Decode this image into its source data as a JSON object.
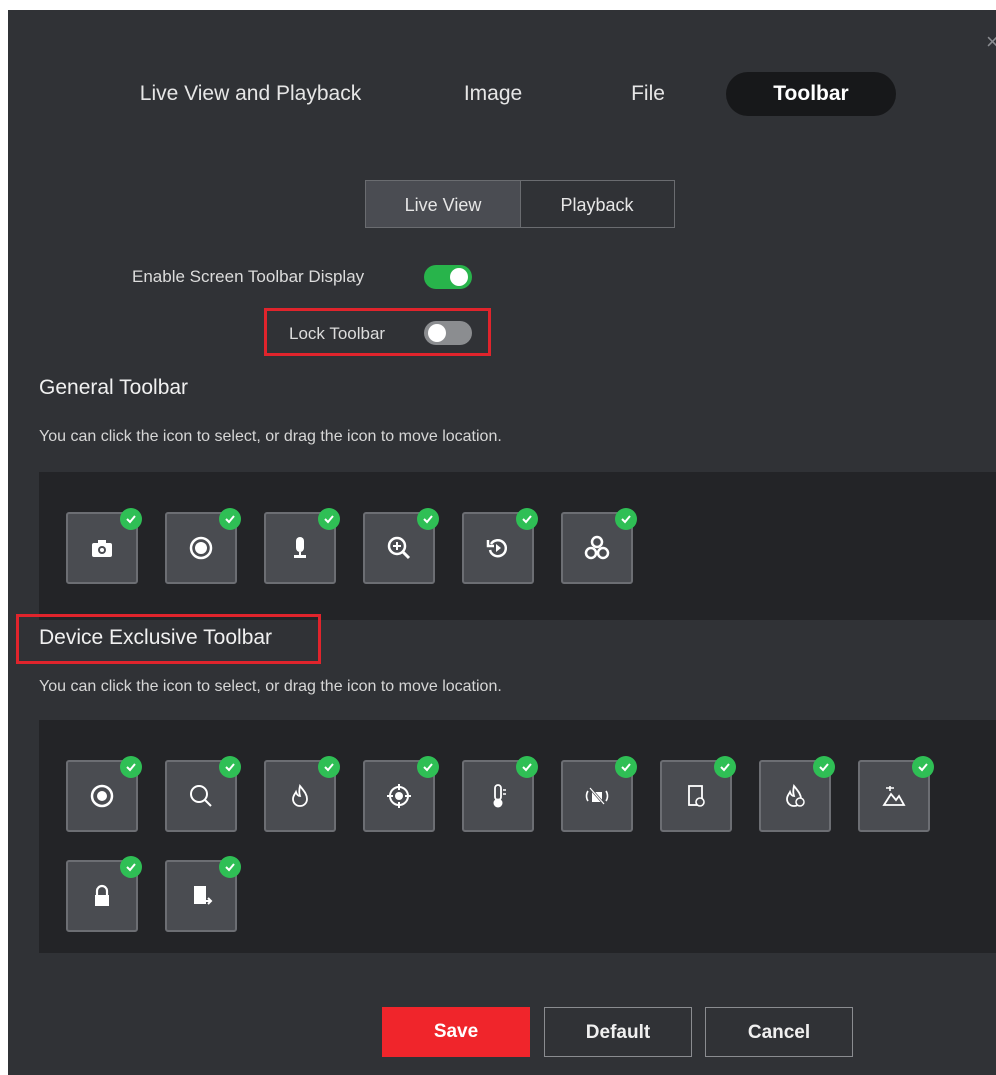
{
  "tabs": [
    {
      "label": "Live View and Playback",
      "active": false
    },
    {
      "label": "Image",
      "active": false
    },
    {
      "label": "File",
      "active": false
    },
    {
      "label": "Toolbar",
      "active": true
    }
  ],
  "segments": [
    {
      "label": "Live View",
      "active": true
    },
    {
      "label": "Playback",
      "active": false
    }
  ],
  "settings": {
    "enable_screen_toolbar": {
      "label": "Enable Screen Toolbar Display",
      "on": true
    },
    "lock_toolbar": {
      "label": "Lock Toolbar",
      "on": false
    }
  },
  "general_toolbar": {
    "title": "General Toolbar",
    "hint": "You can click the icon to select, or drag the icon to move location.",
    "icons": [
      "camera-icon",
      "record-icon",
      "microphone-icon",
      "digital-zoom-icon",
      "instant-playback-icon",
      "fisheye-icon"
    ]
  },
  "device_toolbar": {
    "title": "Device Exclusive Toolbar",
    "hint": "You can click the icon to select, or drag the icon to move location.",
    "icons": [
      "target-icon",
      "search-icon",
      "fire-icon",
      "crosshair-icon",
      "thermometer-icon",
      "alarm-mute-icon",
      "device-link-icon",
      "fire-source-icon",
      "terrain-icon",
      "lock-icon",
      "export-icon"
    ]
  },
  "colors": {
    "accent_green": "#28b44b",
    "check_green": "#2fbf55",
    "primary_red": "#f0252b",
    "highlight_red": "#e0242c",
    "background": "#303236"
  },
  "buttons": {
    "save": "Save",
    "default": "Default",
    "cancel": "Cancel"
  }
}
